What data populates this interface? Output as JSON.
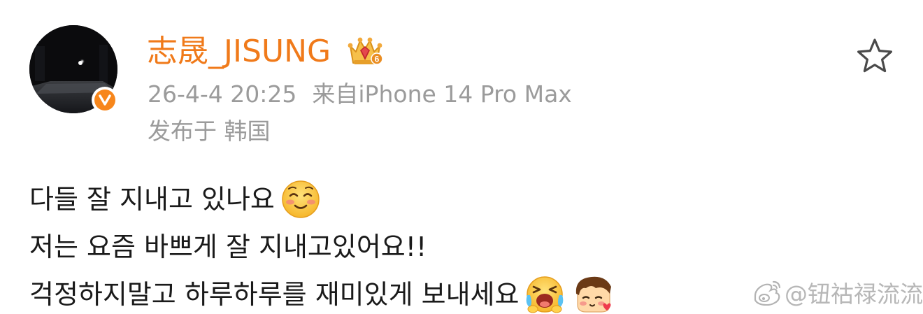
{
  "user": {
    "name": "志晟_JISUNG",
    "avatar_icon": "avatar-photo",
    "verified_icon": "verified-v-badge",
    "member_icon": "crown-member-badge",
    "member_level": "6"
  },
  "post_meta": {
    "timestamp": "26-4-4 20:25",
    "source": "来自iPhone 14 Pro Max",
    "location": "发布于 韩国"
  },
  "actions": {
    "favorite_icon": "star-icon"
  },
  "content": {
    "line1": "다들 잘 지내고 있나요",
    "line2": "저는 요즘 바쁘게 잘 지내고있어요!!",
    "line3": "걱정하지말고 하루하루를 재미있게 보내세요"
  },
  "emojis": [
    "smiling-face-icon",
    "crying-laughing-face-icon",
    "shy-boy-face-icon"
  ],
  "watermark": {
    "icon": "weibo-logo-icon",
    "text": "@钮祜禄流流"
  },
  "colors": {
    "accent": "#f07a1a",
    "meta_text": "#9b9b9b",
    "body_text": "#1a1a1a",
    "verified_badge": "#f7861b"
  }
}
